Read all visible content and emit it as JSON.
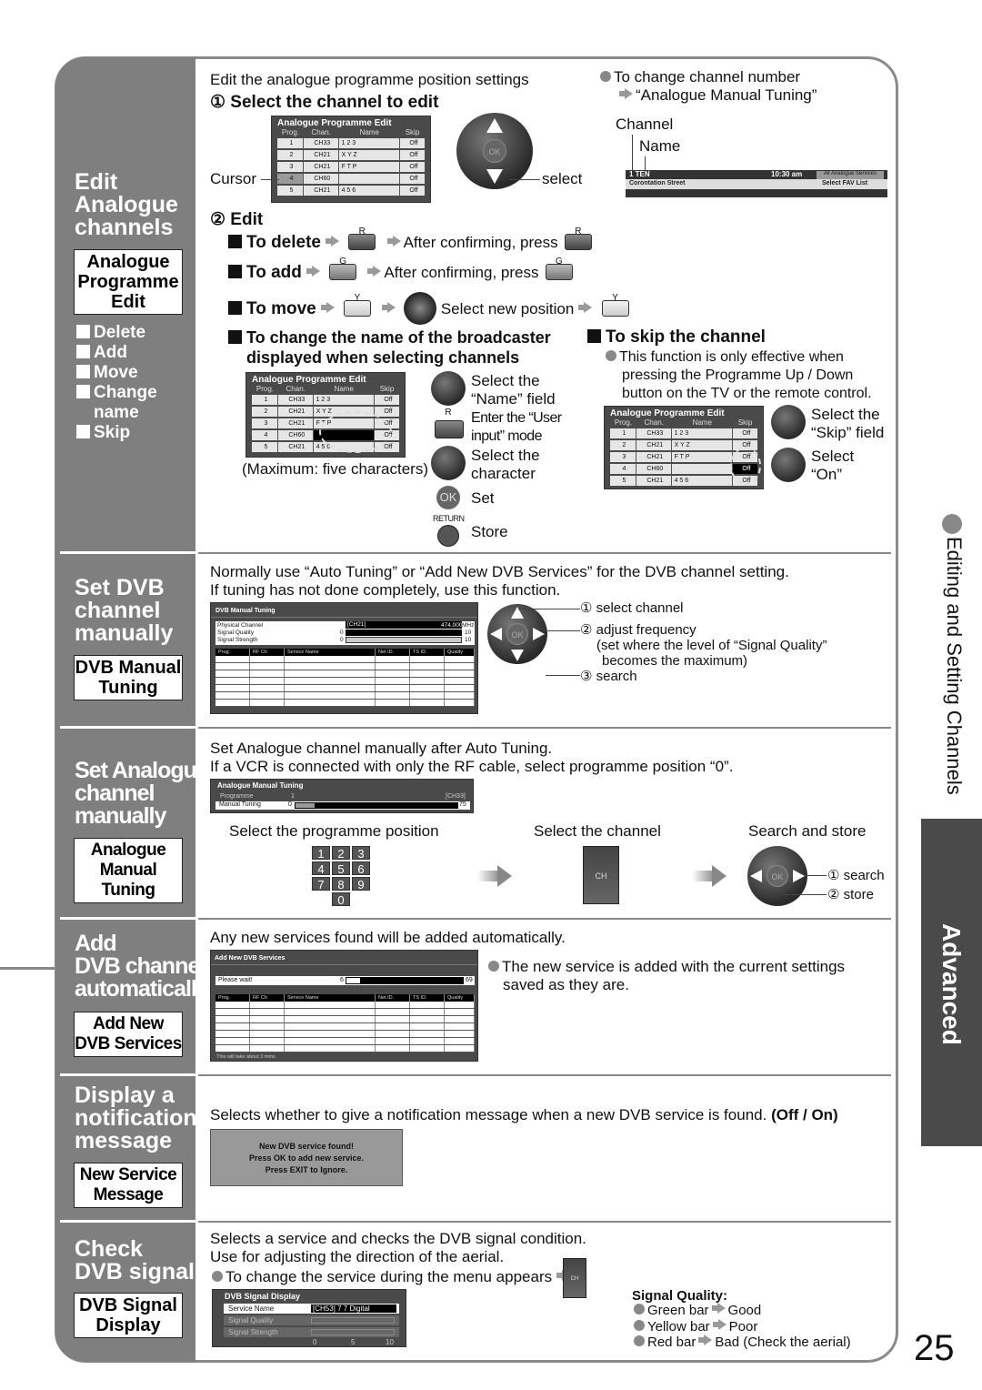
{
  "page_number": "25",
  "side_tab": {
    "label": "Advanced"
  },
  "side_heading": {
    "label": "Editing and Setting Channels"
  },
  "sections": [
    {
      "title": [
        "Edit",
        "Analogue",
        "channels"
      ],
      "menu": [
        "Analogue",
        "Programme",
        "Edit"
      ],
      "list": [
        "Delete",
        "Add",
        "Move",
        "Change",
        "name",
        "Skip"
      ]
    },
    {
      "title": [
        "Set DVB",
        "channel",
        "manually"
      ],
      "menu": [
        "DVB Manual",
        "Tuning"
      ]
    },
    {
      "title": [
        "Set Analogue",
        "channel",
        "manually"
      ],
      "menu": [
        "Analogue",
        "Manual Tuning"
      ]
    },
    {
      "title": [
        "Add",
        "DVB channel",
        "automatically"
      ],
      "menu": [
        "Add New",
        "DVB Services"
      ]
    },
    {
      "title": [
        "Display a",
        "notification",
        "message"
      ],
      "menu": [
        "New Service",
        "Message"
      ]
    },
    {
      "title": [
        "Check",
        "DVB signal"
      ],
      "menu": [
        "DVB Signal",
        "Display"
      ]
    }
  ],
  "edit_analogue": {
    "intro": "Edit the analogue programme position settings",
    "step1": "① Select the channel to edit",
    "cursor_label": "Cursor",
    "select_label": "select",
    "ok_label": "OK",
    "change_number_note": "To change channel number",
    "change_number_target": "“Analogue Manual Tuning”",
    "channel_label": "Channel",
    "name_label": "Name",
    "banner": {
      "channel": "1 TEN",
      "time": "10:30 am",
      "list": "All Analogue Services",
      "programme": "Corontation Street",
      "fav": "Select FAV List"
    },
    "osd": {
      "title": "Analogue Programme Edit",
      "columns": [
        "Prog.",
        "Chan.",
        "Name",
        "Skip"
      ],
      "rows": [
        [
          "1",
          "CH33",
          "1 2 3",
          "Off"
        ],
        [
          "2",
          "CH21",
          "X Y Z",
          "Off"
        ],
        [
          "3",
          "CH21",
          "F T P",
          "Off"
        ],
        [
          "4",
          "CH60",
          "",
          "Off"
        ],
        [
          "5",
          "CH21",
          "4 5 6",
          "Off"
        ]
      ]
    },
    "step2": "② Edit",
    "delete": {
      "label": "To delete",
      "btn": "R",
      "after": "After confirming, press"
    },
    "add": {
      "label": "To add",
      "btn": "G",
      "after": "After confirming, press"
    },
    "move": {
      "label": "To move",
      "btn": "Y",
      "after": "Select new position"
    },
    "rename": {
      "heading": [
        "To change the name of the broadcaster",
        "displayed when selecting channels"
      ],
      "max_note": "(Maximum: five characters)",
      "steps": [
        "Select the",
        "“Name” field",
        "Enter the “User",
        "input” mode",
        "Select the",
        "character",
        "Set",
        "Store"
      ],
      "r_label": "R",
      "return_label": "RETURN"
    },
    "skip": {
      "heading": "To skip the channel",
      "note": [
        "This function is only effective when",
        "pressing the Programme Up / Down",
        "button on the TV or the remote control."
      ],
      "steps": [
        "Select the",
        "“Skip” field",
        "Select",
        "“On”"
      ]
    }
  },
  "dvb_manual": {
    "intro": [
      "Normally use “Auto Tuning” or “Add New DVB Services” for the DVB channel setting.",
      "If tuning has not done completely, use this function."
    ],
    "osd": {
      "title": "DVB Manual Tuning",
      "physical_channel": "Physical Channel",
      "channel_value": "[CH21]",
      "frequency": "474.000",
      "unit": "MHz",
      "signal_quality": "Signal Quality",
      "signal_strength": "Signal Strength",
      "min": "0",
      "max": "10",
      "columns": [
        "Prog.",
        "RF Ch",
        "Service Name",
        "Net ID.",
        "TS ID.",
        "Quality"
      ]
    },
    "steps": [
      "① select channel",
      "② adjust frequency",
      "(set where the level of “Signal Quality”",
      "becomes the maximum)",
      "③ search"
    ]
  },
  "analogue_manual": {
    "intro": [
      "Set Analogue channel manually after Auto Tuning.",
      "If a VCR is connected with only the RF cable, select programme position “0”."
    ],
    "osd": {
      "title": "Analogue Manual Tuning",
      "programme_label": "Programme",
      "programme_value": "1",
      "channel": "[CH33]",
      "tuning_label": "Manual Tuning",
      "min": "0",
      "max": "75",
      "level": 0.12
    },
    "step_labels": [
      "Select the programme position",
      "Select the channel",
      "Search and store"
    ],
    "keys": [
      "1",
      "2",
      "3",
      "4",
      "5",
      "6",
      "7",
      "8",
      "9",
      "0"
    ],
    "ch_label": "CH",
    "search_steps": [
      "① search",
      "② store"
    ]
  },
  "add_dvb": {
    "intro": "Any new services found will be added automatically.",
    "note": [
      "The new service is added with the current settings",
      "saved as they are."
    ],
    "osd": {
      "title": "Add New DVB Services",
      "wait": "Please wait!",
      "progress_min": "6",
      "progress_max": "69",
      "progress": 0.12,
      "columns": [
        "Prog.",
        "RF Ch",
        "Service Name",
        "Net ID.",
        "TS ID.",
        "Quality"
      ],
      "footer": "This will take about 3 mins."
    }
  },
  "notification": {
    "intro": "Selects whether to give a notification message when a new DVB service is found.",
    "options": "(Off / On)",
    "message": [
      "New DVB service found!",
      "Press OK to add new service.",
      "Press EXIT to Ignore."
    ]
  },
  "signal": {
    "intro": [
      "Selects a service and checks the DVB signal condition.",
      "Use for adjusting the direction of the aerial."
    ],
    "change_note": "To change the service during the menu appears",
    "ch_label": "CH",
    "osd": {
      "title": "DVB Signal Display",
      "service_label": "Service Name",
      "service_value": "[CH53] 7 7 Digital",
      "quality_label": "Signal Quality",
      "strength_label": "Signal Strength",
      "scale": [
        "0",
        "5",
        "10"
      ]
    },
    "quality_heading": "Signal Quality:",
    "quality_items": [
      {
        "bar": "Green bar",
        "meaning": "Good"
      },
      {
        "bar": "Yellow bar",
        "meaning": "Poor"
      },
      {
        "bar": "Red bar",
        "meaning": "Bad (Check the aerial)"
      }
    ]
  }
}
